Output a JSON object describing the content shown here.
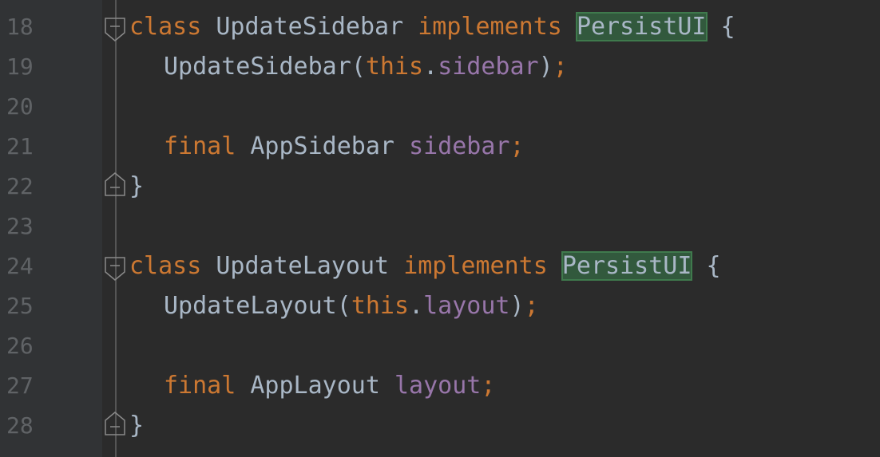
{
  "theme": {
    "background": "#2b2b2b",
    "gutter": "#313335",
    "line_number": "#606366",
    "keyword": "#cc7832",
    "field": "#9876aa",
    "text": "#a9b7c6",
    "highlight_bg": "#32593d"
  },
  "lines": [
    {
      "num": "18",
      "kw1": "class",
      "name": "UpdateSidebar",
      "kw2": "implements",
      "iface": "PersistUI",
      "brace": "{"
    },
    {
      "num": "19",
      "ctor": "UpdateSidebar",
      "open": "(",
      "thiskw": "this",
      "dot": ".",
      "field": "sidebar",
      "close": ")",
      "semi": ";"
    },
    {
      "num": "20"
    },
    {
      "num": "21",
      "kw": "final",
      "type": "AppSidebar",
      "field": "sidebar",
      "semi": ";"
    },
    {
      "num": "22",
      "brace": "}"
    },
    {
      "num": "23"
    },
    {
      "num": "24",
      "kw1": "class",
      "name": "UpdateLayout",
      "kw2": "implements",
      "iface": "PersistUI",
      "brace": "{"
    },
    {
      "num": "25",
      "ctor": "UpdateLayout",
      "open": "(",
      "thiskw": "this",
      "dot": ".",
      "field": "layout",
      "close": ")",
      "semi": ";"
    },
    {
      "num": "26"
    },
    {
      "num": "27",
      "kw": "final",
      "type": "AppLayout",
      "field": "layout",
      "semi": ";"
    },
    {
      "num": "28",
      "brace": "}"
    }
  ],
  "icons": {
    "fold_start": "fold-collapse-icon",
    "fold_end": "fold-end-icon"
  }
}
